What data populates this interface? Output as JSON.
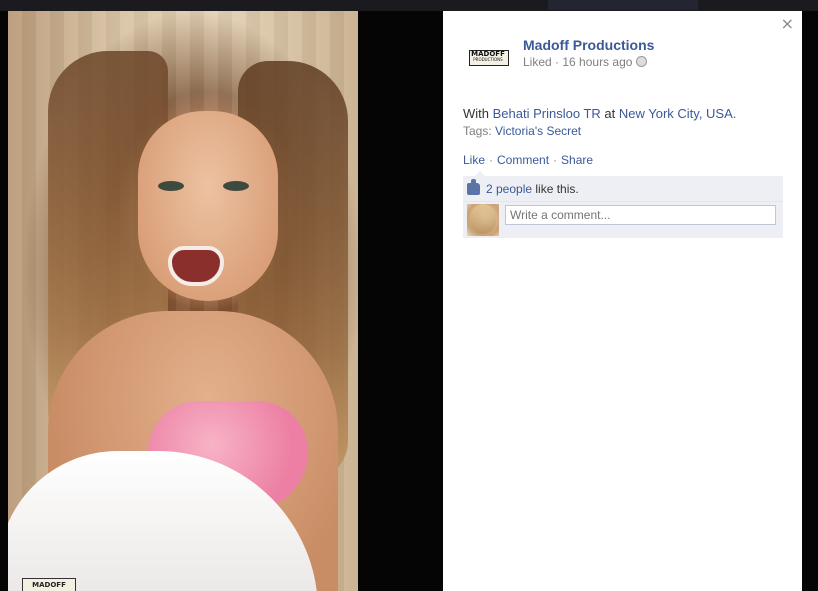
{
  "post": {
    "page_name": "Madoff Productions",
    "status": "Liked",
    "separator": " · ",
    "time": "16 hours ago",
    "caption": {
      "prefix": "With ",
      "person": "Behati Prinsloo TR",
      "mid": " at ",
      "place": "New York City, USA."
    },
    "tags_label": "Tags: ",
    "tag": "Victoria's Secret"
  },
  "logo": {
    "line1": "MADOFF",
    "line2": "PRODUCTIONS"
  },
  "actions": {
    "like": "Like",
    "comment": "Comment",
    "share": "Share",
    "dot": "·"
  },
  "likes": {
    "count_link": "2 people",
    "suffix": " like this."
  },
  "comment_box": {
    "placeholder": "Write a comment..."
  },
  "photo": {
    "watermark": "MADOFF"
  },
  "close_label": "×",
  "colors": {
    "link": "#3b5998",
    "muted": "#808080",
    "feedback_bg": "#edeff4"
  }
}
